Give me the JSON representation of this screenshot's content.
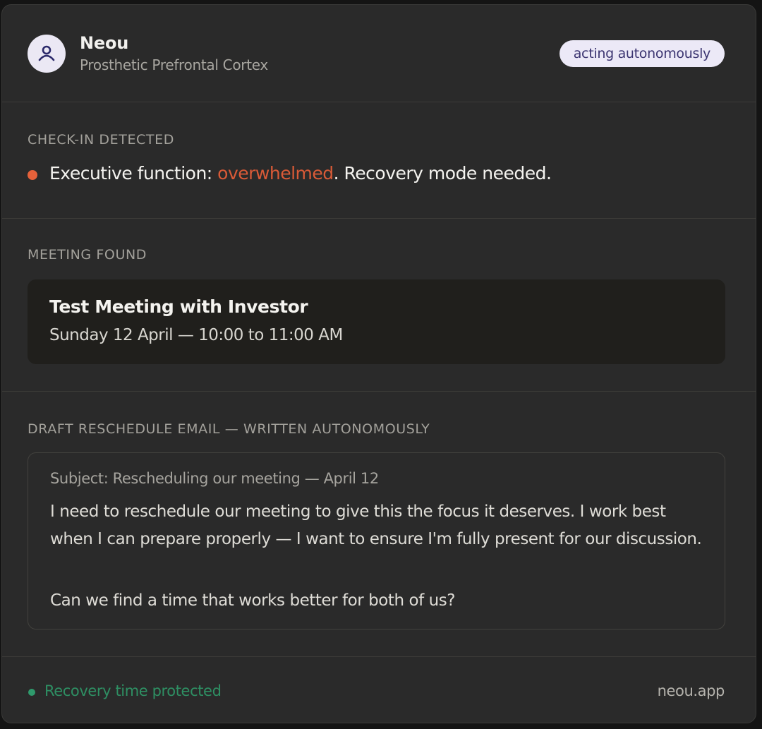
{
  "header": {
    "app_name": "Neou",
    "app_subtitle": "Prosthetic Prefrontal Cortex",
    "avatar_icon": "user-icon",
    "status_badge": "acting autonomously"
  },
  "checkin": {
    "label": "CHECK-IN DETECTED",
    "prefix": "Executive function: ",
    "state": "overwhelmed",
    "suffix": ". Recovery mode needed.",
    "dot_color": "#e5613a",
    "state_color": "#d95a37"
  },
  "meeting": {
    "label": "MEETING FOUND",
    "title": "Test Meeting with Investor",
    "time": "Sunday 12 April — 10:00 to 11:00 AM"
  },
  "email": {
    "label": "DRAFT RESCHEDULE EMAIL — WRITTEN AUTONOMOUSLY",
    "subject": "Subject: Rescheduling our meeting — April 12",
    "body": "I need to reschedule our meeting to give this the focus it deserves. I work best when I can prepare properly — I want to ensure I'm fully present for our discussion.",
    "closing": "Can we find a time that works better for both of us?"
  },
  "footer": {
    "status": "Recovery time protected",
    "status_color": "#2f9a6c",
    "link": "neou.app"
  }
}
